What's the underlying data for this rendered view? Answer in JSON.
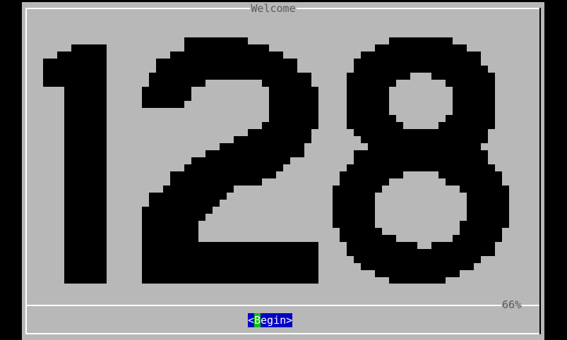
{
  "dialog": {
    "title": "Welcome",
    "display_number": "128",
    "progress_label": "66%",
    "progress": 0.66
  },
  "buttons": {
    "begin": {
      "left_bracket": "<",
      "hotkey": "B",
      "rest": "egin",
      "right_bracket": ">"
    }
  },
  "colors": {
    "background": "#000000",
    "dialog_bg": "#b8b8b8",
    "digit_fill": "#000000",
    "button_bg": "#0000c8",
    "button_hotkey_bg": "#00c800",
    "label_text": "#5a5a5a"
  }
}
